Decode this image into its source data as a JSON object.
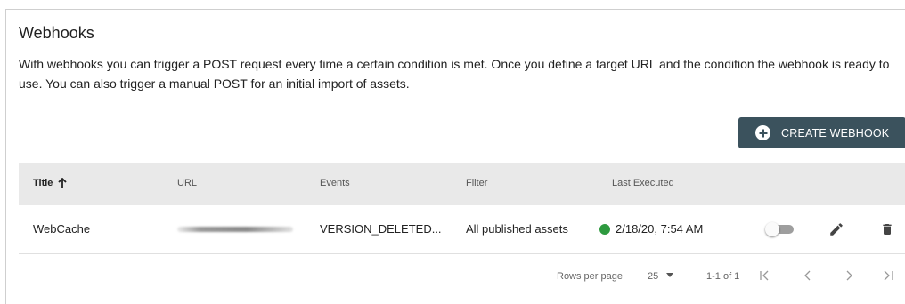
{
  "header": {
    "title": "Webhooks",
    "description": "With webhooks you can trigger a POST request every time a certain condition is met. Once you define a target URL and the condition the webhook is ready to use. You can also trigger a manual POST for an initial import of assets."
  },
  "actions": {
    "create_label": "CREATE WEBHOOK",
    "create_icon": "plus-circle-icon",
    "accent_color": "#3b525d"
  },
  "table": {
    "columns": {
      "title": "Title",
      "url": "URL",
      "events": "Events",
      "filter": "Filter",
      "last_executed": "Last Executed"
    },
    "sort": {
      "column": "Title",
      "direction": "ascending"
    },
    "rows": [
      {
        "title": "WebCache",
        "url_redacted": true,
        "events": "VERSION_DELETED...",
        "filter": "All published assets",
        "last_executed": "2/18/20, 7:54 AM",
        "status_color": "#2e9a3f",
        "enabled": false
      }
    ]
  },
  "pagination": {
    "rows_per_page_label": "Rows per page",
    "rows_per_page_value": "25",
    "range": "1-1 of 1"
  }
}
